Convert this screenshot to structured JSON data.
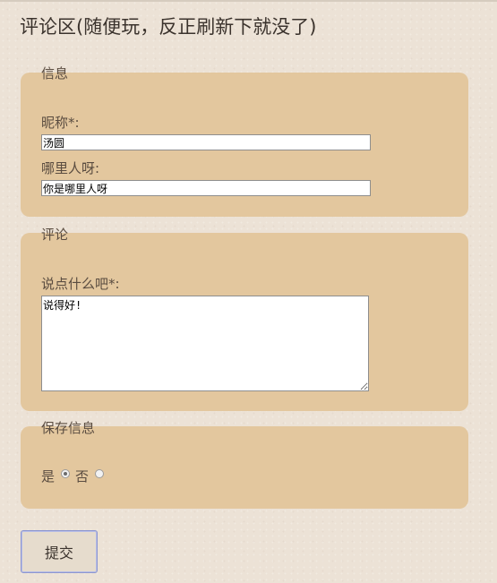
{
  "page": {
    "title": "评论区(随便玩，反正刷新下就没了)"
  },
  "info_section": {
    "legend": "信息",
    "nickname_label": "昵称*:",
    "nickname_value": "汤圆",
    "location_label": "哪里人呀:",
    "location_value": "你是哪里人呀"
  },
  "comment_section": {
    "legend": "评论",
    "comment_label": "说点什么吧*:",
    "comment_value": "说得好!"
  },
  "save_section": {
    "legend": "保存信息",
    "options": [
      {
        "label": "是",
        "checked": true
      },
      {
        "label": "否",
        "checked": false
      }
    ]
  },
  "submit_label": "提交"
}
